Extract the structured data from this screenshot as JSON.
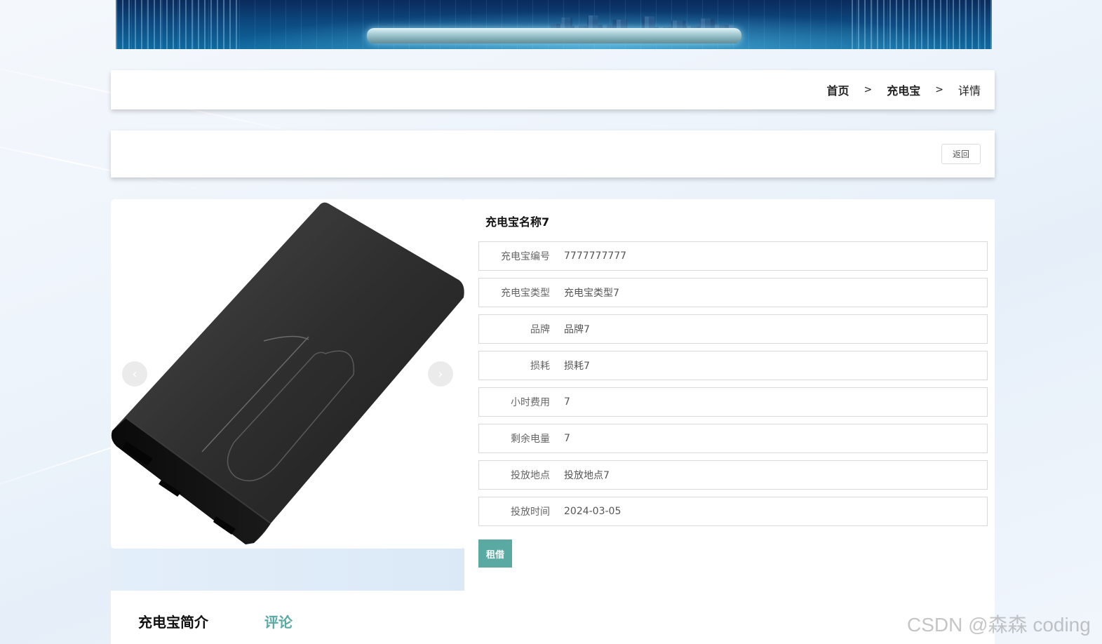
{
  "breadcrumb": {
    "home": "首页",
    "section": "充电宝",
    "current": "详情",
    "separator": ">"
  },
  "actions": {
    "back_label": "返回"
  },
  "carousel": {
    "prev_icon": "‹",
    "next_icon": "›"
  },
  "product": {
    "name": "充电宝名称7",
    "fields": [
      {
        "label": "充电宝编号",
        "value": "7777777777"
      },
      {
        "label": "充电宝类型",
        "value": "充电宝类型7"
      },
      {
        "label": "品牌",
        "value": "品牌7"
      },
      {
        "label": "损耗",
        "value": "损耗7"
      },
      {
        "label": "小时费用",
        "value": "7"
      },
      {
        "label": "剩余电量",
        "value": "7"
      },
      {
        "label": "投放地点",
        "value": "投放地点7"
      },
      {
        "label": "投放时间",
        "value": "2024-03-05"
      }
    ],
    "rent_label": "租借"
  },
  "tabs": {
    "intro": "充电宝简介",
    "comments": "评论"
  },
  "colors": {
    "accent": "#5aa9a2"
  },
  "watermark": "CSDN @森森 coding"
}
